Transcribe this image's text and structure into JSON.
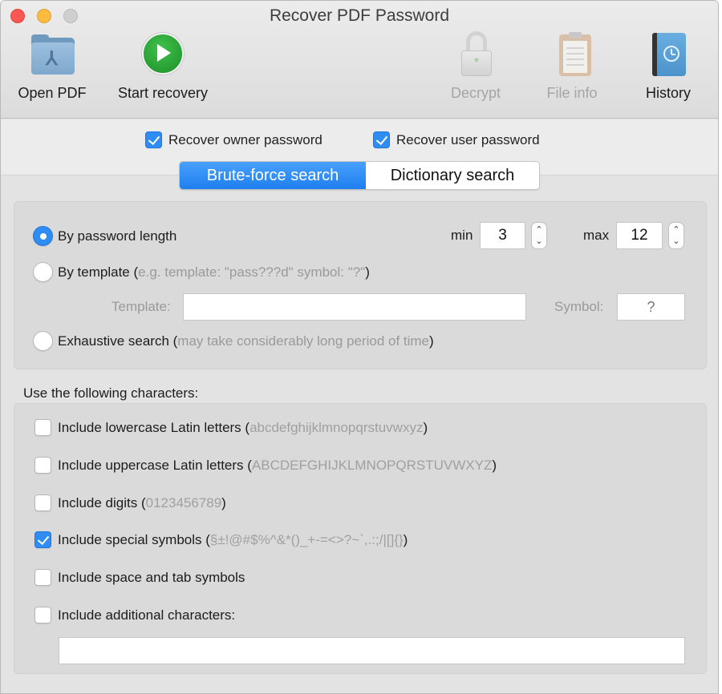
{
  "window": {
    "title": "Recover PDF Password"
  },
  "toolbar": {
    "items": [
      {
        "label": "Open PDF",
        "icon": "folder-pdf-icon",
        "enabled": true
      },
      {
        "label": "Start recovery",
        "icon": "play-icon",
        "enabled": true
      },
      {
        "label": "Decrypt",
        "icon": "unlock-icon",
        "enabled": false
      },
      {
        "label": "File info",
        "icon": "clipboard-icon",
        "enabled": false
      },
      {
        "label": "History",
        "icon": "history-book-icon",
        "enabled": true
      }
    ]
  },
  "recover_options": {
    "owner": {
      "label": "Recover owner password",
      "checked": true
    },
    "user": {
      "label": "Recover user password",
      "checked": true
    }
  },
  "tabs": [
    {
      "label": "Brute-force search",
      "selected": true
    },
    {
      "label": "Dictionary search",
      "selected": false
    }
  ],
  "mode": {
    "by_length": {
      "label": "By password length",
      "selected": true
    },
    "by_template": {
      "label": "By template (",
      "hint": " e.g. template: \"pass???d\" symbol: \"?\" ",
      "close": ")",
      "selected": false
    },
    "exhaustive": {
      "label": "Exhaustive search (",
      "hint": " may take considerably long period of time ",
      "close": ")",
      "selected": false
    },
    "min_label": "min",
    "min_value": "3",
    "max_label": "max",
    "max_value": "12",
    "stepper_glyph_up": "⌃",
    "stepper_glyph_down": "⌄",
    "template_label": "Template:",
    "template_value": "",
    "symbol_label": "Symbol:",
    "symbol_value": "?"
  },
  "characters": {
    "section_title": "Use the following characters:",
    "options": [
      {
        "label": "Include lowercase Latin letters (",
        "set": "abcdefghijklmnopqrstuvwxyz",
        "close": ")",
        "checked": false
      },
      {
        "label": "Include uppercase Latin letters (",
        "set": "ABCDEFGHIJKLMNOPQRSTUVWXYZ",
        "close": ")",
        "checked": false
      },
      {
        "label": "Include digits (",
        "set": "0123456789",
        "close": ")",
        "checked": false
      },
      {
        "label": "Include special symbols (",
        "set": "§±!@#$%^&*()_+-=<>?~`,.:;/|[]{}",
        "close": ")",
        "checked": true
      },
      {
        "label": "Include space and tab symbols",
        "set": "",
        "close": "",
        "checked": false
      },
      {
        "label": "Include additional characters:",
        "set": "",
        "close": "",
        "checked": false
      }
    ],
    "additional_value": ""
  },
  "colors": {
    "accent": "#2f8cf3",
    "close": "#fc5753",
    "minimize": "#fdbc40",
    "zoom_disabled": "#cfcfcf",
    "hint_text": "#9a9a9a"
  }
}
